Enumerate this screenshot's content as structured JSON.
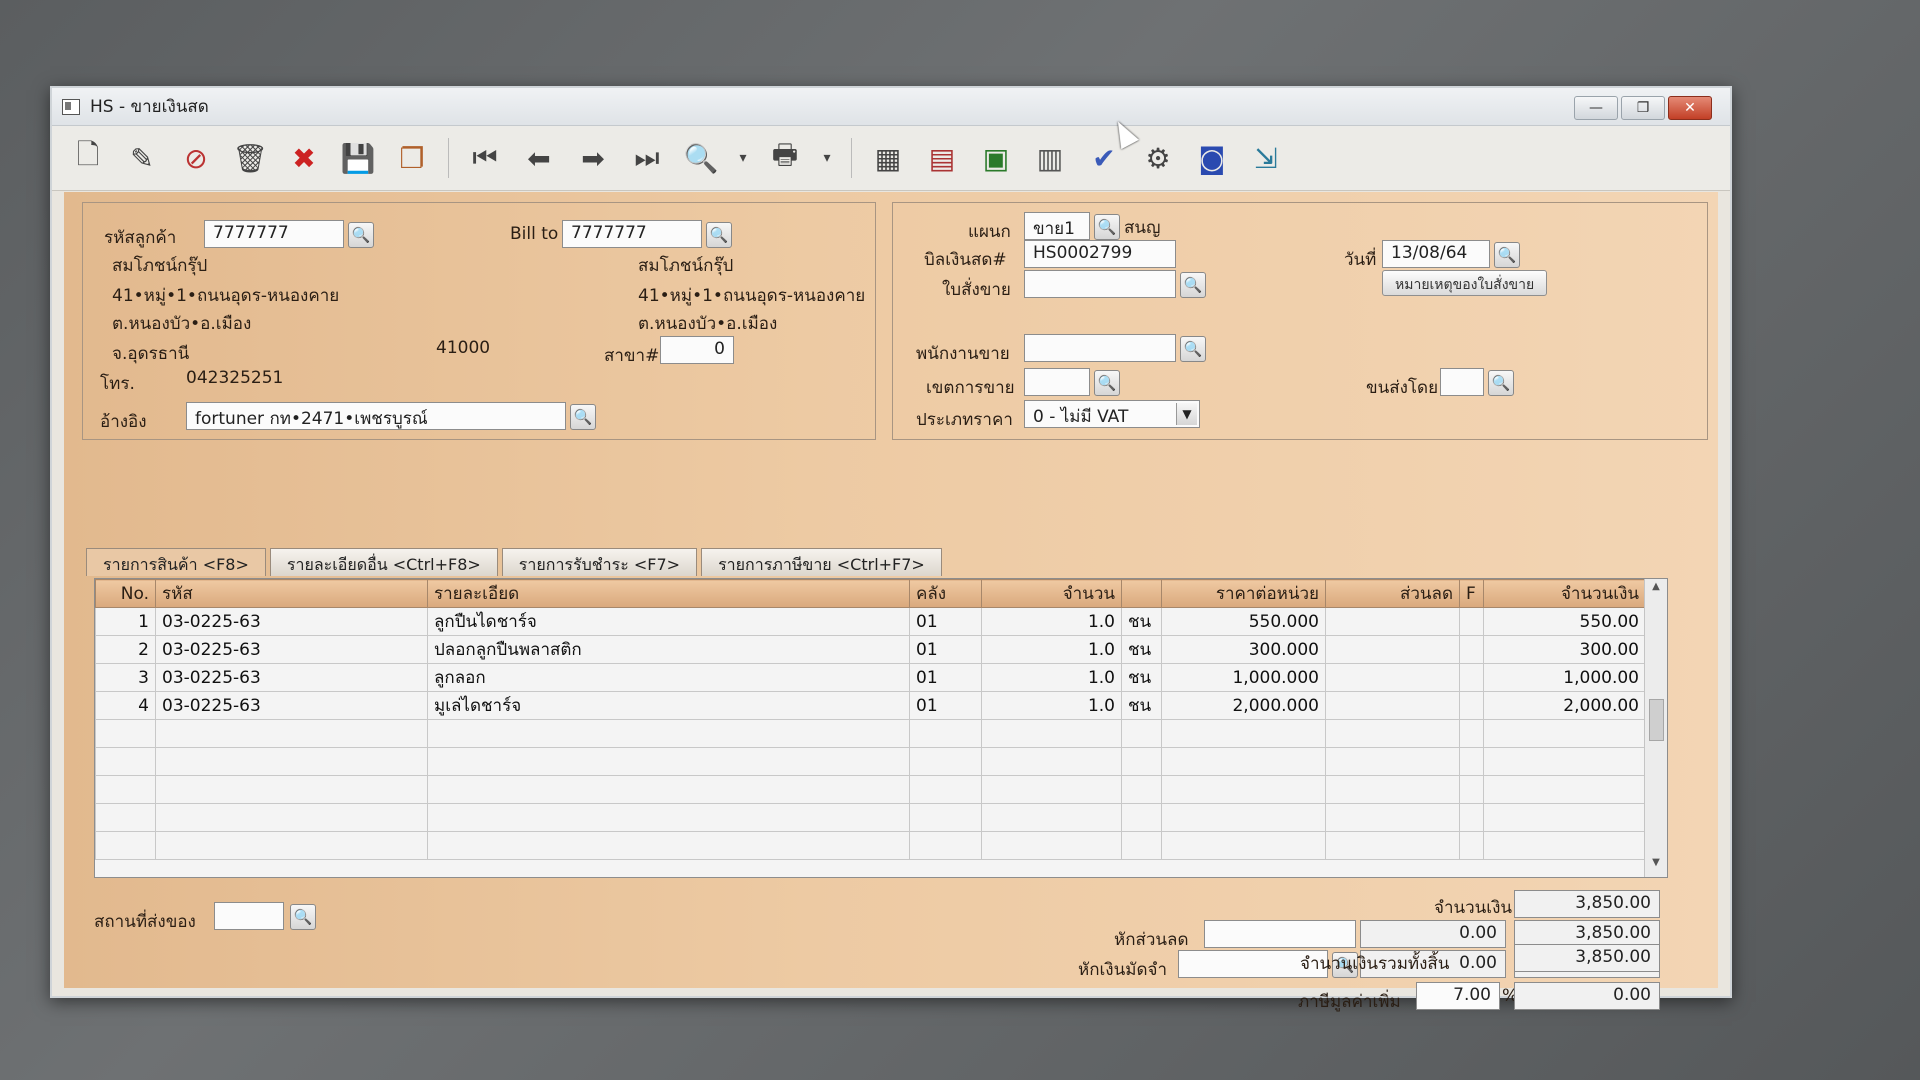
{
  "window": {
    "title": "HS - ขายเงินสด"
  },
  "window_buttons": {
    "minimize": "—",
    "maximize": "❐",
    "close": "✕"
  },
  "toolbar": {
    "icons": [
      "new-icon",
      "edit-icon",
      "void-icon",
      "delete-icon",
      "cancel-icon",
      "save-icon",
      "copy-icon",
      "first-record-icon",
      "previous-record-icon",
      "next-record-icon",
      "last-record-icon",
      "search-icon",
      "search-dropdown-icon",
      "print-icon",
      "print-dropdown-icon",
      "calculator-icon",
      "form-icon",
      "report-icon",
      "receipt-icon",
      "approve-icon",
      "tools-icon",
      "ok-icon",
      "exit-icon"
    ]
  },
  "customer": {
    "code_label": "รหัสลูกค้า",
    "code_value": "7777777",
    "name": "สมโภชน์กรุ๊ป",
    "address1": "41•หมู่•1•ถนนอุดร-หนองคาย",
    "address2": "ต.หนองบัว•อ.เมือง",
    "province": "จ.อุดรธานี",
    "postcode": "41000",
    "phone_label": "โทร.",
    "phone_value": "042325251",
    "ref_label": "อ้างอิง",
    "ref_value": "fortuner กท•2471•เพชรบูรณ์"
  },
  "bill_to": {
    "label": "Bill to",
    "value": "7777777",
    "name": "สมโภชน์กรุ๊ป",
    "address1": "41•หมู่•1•ถนนอุดร-หนองคาย",
    "address2": "ต.หนองบัว•อ.เมือง",
    "branch_label": "สาขา#",
    "branch_value": "0"
  },
  "header_right": {
    "dept_label": "แผนก",
    "dept_value": "ขาย1",
    "dept_name": "สนญ",
    "bill_no_label": "บิลเงินสด#",
    "bill_no_value": "HS0002799",
    "date_label": "วันที่",
    "date_value": "13/08/64",
    "sales_order_label": "ใบสั่งขาย",
    "sales_order_value": "",
    "note_button": "หมายเหตุของใบสั่งขาย",
    "salesperson_label": "พนักงานขาย",
    "salesperson_value": "",
    "sales_area_label": "เขตการขาย",
    "sales_area_value": "",
    "shipping_label": "ขนส่งโดย",
    "shipping_value": "",
    "price_type_label": "ประเภทราคา",
    "price_type_value": "0 - ไม่มี VAT"
  },
  "tabs": [
    {
      "label": "รายการสินค้า <F8>"
    },
    {
      "label": "รายละเอียดอื่น <Ctrl+F8>"
    },
    {
      "label": "รายการรับชำระ <F7>"
    },
    {
      "label": "รายการภาษีขาย <Ctrl+F7>"
    }
  ],
  "grid": {
    "columns": [
      "No.",
      "รหัส",
      "รายละเอียด",
      "คลัง",
      "จำนวน",
      "",
      "ราคาต่อหน่วย",
      "ส่วนลด",
      "F",
      "จำนวนเงิน"
    ],
    "rows": [
      [
        "1",
        "03-0225-63",
        "ลูกปืนไดชาร์จ",
        "01",
        "1.0",
        "ชน",
        "550.000",
        "",
        "",
        "550.00"
      ],
      [
        "2",
        "03-0225-63",
        "ปลอกลูกปืนพลาสติก",
        "01",
        "1.0",
        "ชน",
        "300.000",
        "",
        "",
        "300.00"
      ],
      [
        "3",
        "03-0225-63",
        "ลูกลอก",
        "01",
        "1.0",
        "ชน",
        "1,000.000",
        "",
        "",
        "1,000.00"
      ],
      [
        "4",
        "03-0225-63",
        "มูเล่ไดชาร์จ",
        "01",
        "1.0",
        "ชน",
        "2,000.000",
        "",
        "",
        "2,000.00"
      ]
    ]
  },
  "footer": {
    "delivery_label": "สถานที่ส่งของ",
    "delivery_value": "",
    "amount_label": "จำนวนเงิน",
    "amount_value": "3,850.00",
    "discount_label": "หักส่วนลด",
    "discount_input": "",
    "discount_amount": "0.00",
    "discount_total": "3,850.00",
    "deposit_label": "หักเงินมัดจำ",
    "deposit_input": "",
    "deposit_amount": "0.00",
    "deposit_total": "3,850.00",
    "vat_label": "ภาษีมูลค่าเพิ่ม",
    "vat_rate": "7.00",
    "vat_pct": "%",
    "vat_amount": "0.00",
    "grand_total_label": "จำนวนเงินรวมทั้งสิ้น",
    "grand_total_value": "3,850.00"
  }
}
